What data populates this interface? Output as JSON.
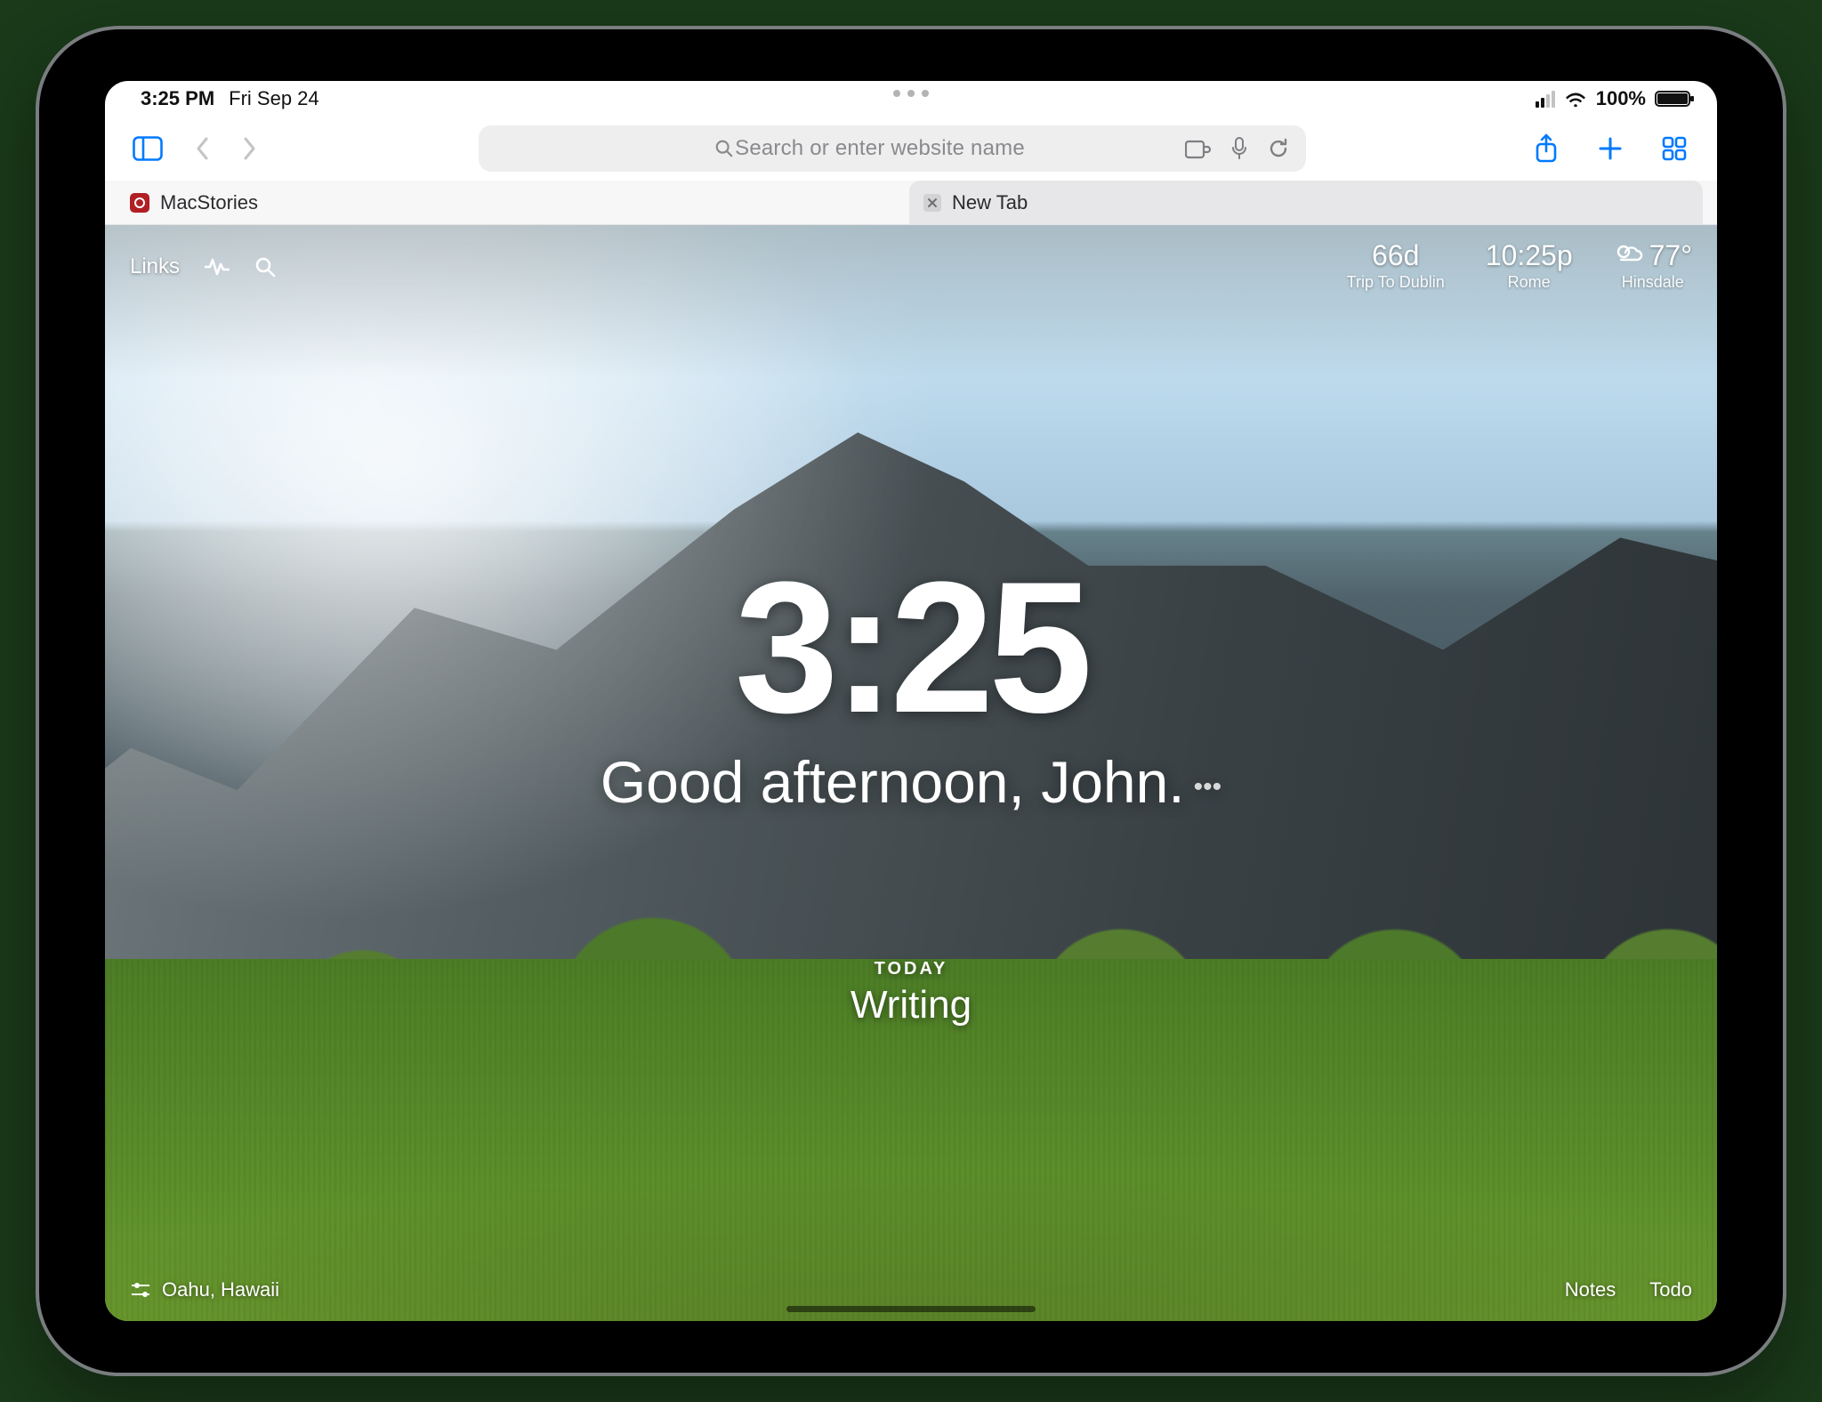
{
  "status": {
    "time": "3:25 PM",
    "date": "Fri Sep 24",
    "battery_pct": "100%"
  },
  "toolbar": {
    "search_placeholder": "Search or enter website name"
  },
  "tabs": [
    {
      "title": "MacStories",
      "active": false
    },
    {
      "title": "New Tab",
      "active": true
    }
  ],
  "momentum": {
    "top_left": {
      "links": "Links"
    },
    "top_right": {
      "countdown": {
        "value": "66d",
        "label": "Trip To Dublin"
      },
      "clock2": {
        "value": "10:25p",
        "label": "Rome"
      },
      "weather": {
        "value": "77°",
        "label": "Hinsdale"
      }
    },
    "clock": "3:25",
    "greeting": "Good afternoon, John.",
    "focus": {
      "label": "TODAY",
      "task": "Writing"
    },
    "bottom_left": {
      "location": "Oahu, Hawaii"
    },
    "bottom_right": {
      "notes": "Notes",
      "todo": "Todo"
    }
  }
}
